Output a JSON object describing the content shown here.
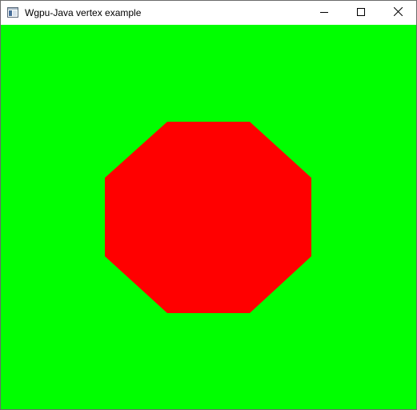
{
  "window": {
    "title": "Wgpu-Java vertex example",
    "app_icon": "window-icon",
    "buttons": {
      "minimize_icon": "minimize-icon",
      "maximize_icon": "maximize-icon",
      "close_icon": "close-icon"
    }
  },
  "canvas": {
    "background_color": "#00ff00",
    "shape": "octagon",
    "shape_color": "#ff0000"
  }
}
